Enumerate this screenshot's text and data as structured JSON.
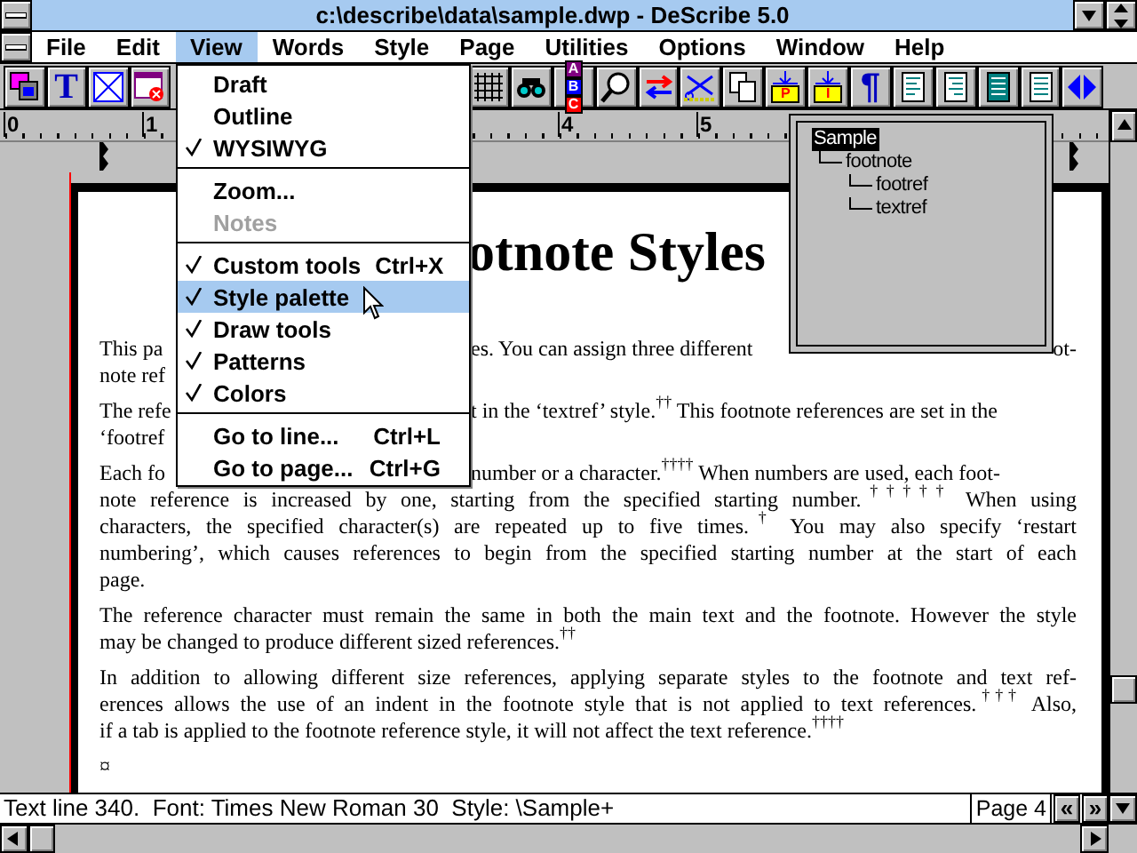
{
  "window": {
    "title": "c:\\describe\\data\\sample.dwp - DeScribe 5.0"
  },
  "menu_bar": [
    {
      "label": "File",
      "selected": false
    },
    {
      "label": "Edit",
      "selected": false
    },
    {
      "label": "View",
      "selected": true
    },
    {
      "label": "Words",
      "selected": false
    },
    {
      "label": "Style",
      "selected": false
    },
    {
      "label": "Page",
      "selected": false
    },
    {
      "label": "Utilities",
      "selected": false
    },
    {
      "label": "Options",
      "selected": false
    },
    {
      "label": "Window",
      "selected": false
    },
    {
      "label": "Help",
      "selected": false
    }
  ],
  "toolbar": {
    "left": [
      {
        "kind": "frames"
      },
      {
        "kind": "letter",
        "glyph": "T"
      },
      {
        "kind": "crossbox"
      },
      {
        "kind": "window-close"
      }
    ],
    "right": [
      {
        "kind": "grid"
      },
      {
        "kind": "binoculars"
      },
      {
        "kind": "blocks",
        "glyphs": [
          "A",
          "B",
          "C"
        ]
      },
      {
        "kind": "magnifier"
      },
      {
        "kind": "arrows"
      },
      {
        "kind": "scissors"
      },
      {
        "kind": "copy"
      },
      {
        "kind": "insert",
        "glyph": "P"
      },
      {
        "kind": "insert",
        "glyph": "I"
      },
      {
        "kind": "pilcrow",
        "glyph": "¶"
      },
      {
        "kind": "align-left"
      },
      {
        "kind": "align-right"
      },
      {
        "kind": "justify-dark"
      },
      {
        "kind": "justify"
      },
      {
        "kind": "nav-arrows"
      }
    ]
  },
  "ruler": {
    "labels": [
      "0",
      "1",
      "4",
      "5"
    ]
  },
  "view_menu": {
    "items": [
      {
        "kind": "item",
        "label": "Draft",
        "checked": false,
        "selected": false,
        "disabled": false
      },
      {
        "kind": "item",
        "label": "Outline",
        "checked": false,
        "selected": false,
        "disabled": false
      },
      {
        "kind": "item",
        "label": "WYSIWYG",
        "checked": true,
        "selected": false,
        "disabled": false
      },
      {
        "kind": "separator"
      },
      {
        "kind": "item",
        "label": "Zoom...",
        "checked": false,
        "selected": false,
        "disabled": false
      },
      {
        "kind": "item",
        "label": "Notes",
        "checked": false,
        "selected": false,
        "disabled": true
      },
      {
        "kind": "separator"
      },
      {
        "kind": "item",
        "label": "Custom tools",
        "shortcut": "Ctrl+X",
        "checked": true,
        "selected": false,
        "disabled": false
      },
      {
        "kind": "item",
        "label": "Style palette",
        "checked": true,
        "selected": true,
        "disabled": false
      },
      {
        "kind": "item",
        "label": "Draw tools",
        "checked": true,
        "selected": false,
        "disabled": false
      },
      {
        "kind": "item",
        "label": "Patterns",
        "checked": true,
        "selected": false,
        "disabled": false
      },
      {
        "kind": "item",
        "label": "Colors",
        "checked": true,
        "selected": false,
        "disabled": false
      },
      {
        "kind": "separator"
      },
      {
        "kind": "item",
        "label": "Go to line...",
        "shortcut": "Ctrl+L",
        "checked": false,
        "selected": false,
        "disabled": false
      },
      {
        "kind": "item",
        "label": "Go to page...",
        "shortcut": "Ctrl+G",
        "checked": false,
        "selected": false,
        "disabled": false
      }
    ]
  },
  "document": {
    "title": "otnote Styles",
    "paragraphs": [
      {
        "lines": [
          [
            "This pa",
            "es. You can assign three different",
            "ot-"
          ],
          [
            "note ref"
          ]
        ]
      },
      {
        "lines": [
          [
            "The refe",
            "t in the ‘textref’ style.$^{††}$ This footnote references are set in the"
          ],
          [
            "‘footref"
          ]
        ]
      },
      {
        "lines": [
          [
            "Each fo",
            "number or a character.$^{††††}$ When numbers are used, each foot-"
          ],
          [
            "note reference is increased by one, starting from the specified starting number.$^{†††††}$ When using"
          ],
          [
            "characters, the specified character(s) are repeated up to five times.$^{†}$ You may also specify ‘restart"
          ],
          [
            "numbering’, which causes references to begin from the specified starting number at the start of each"
          ],
          [
            "page."
          ]
        ]
      },
      {
        "lines": [
          [
            "The reference character must remain the same in both the main text and the footnote. However the style"
          ],
          [
            "may be changed to produce different sized references.$^{††}$"
          ]
        ]
      },
      {
        "lines": [
          [
            "In addition to allowing different size references, applying separate styles to the footnote and text ref-"
          ],
          [
            "erences allows the use of  an indent in the footnote style that is not applied to text references.$^{†††}$ Also,"
          ],
          [
            "if a tab is applied to the footnote reference style, it will not affect the text reference.$^{††††}$"
          ]
        ]
      }
    ],
    "end_mark": "¤"
  },
  "style_palette": {
    "tree": [
      {
        "label": "Sample",
        "selected": true,
        "children": [
          {
            "label": "footnote",
            "selected": false,
            "children": [
              {
                "label": "footref",
                "selected": false
              },
              {
                "label": "textref",
                "selected": false
              }
            ]
          }
        ]
      }
    ]
  },
  "status_bar": {
    "text": "Text line 340.  Font: Times New Roman 30  Style: \\Sample+",
    "page": "Page 4",
    "prev": "«",
    "next": "»"
  }
}
